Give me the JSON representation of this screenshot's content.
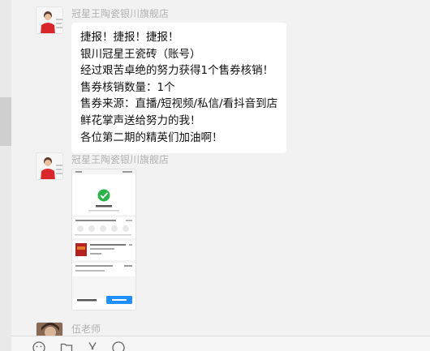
{
  "messages": [
    {
      "sender": "冠星王陶瓷银川旗舰店",
      "avatar_icon": "person-red-shirt-avatar",
      "lines": [
        "捷报！捷报！捷报！",
        "银川冠星王瓷砖（账号）",
        "经过艰苦卓绝的努力获得1个售券核销！",
        "售券核销数量：1个",
        "售券来源：直播/短视频/私信/看抖音到店",
        "鲜花掌声送给努力的我！",
        "各位第二期的精英们加油啊！"
      ]
    },
    {
      "sender": "冠星王陶瓷银川旗舰店",
      "avatar_icon": "person-red-shirt-avatar",
      "attachment": "phone-screenshot-image"
    },
    {
      "sender": "伍老师",
      "avatar_icon": "person-photo-avatar"
    }
  ],
  "toolbar": {
    "icons": [
      "emoji-icon",
      "folder-icon",
      "scissors-icon",
      "chat-history-icon"
    ]
  },
  "colors": {
    "background": "#f2f2f2",
    "bubble": "#ffffff",
    "sender_name": "#b2b2b2",
    "accent_green": "#2bb34a",
    "accent_blue": "#1f8fff"
  }
}
